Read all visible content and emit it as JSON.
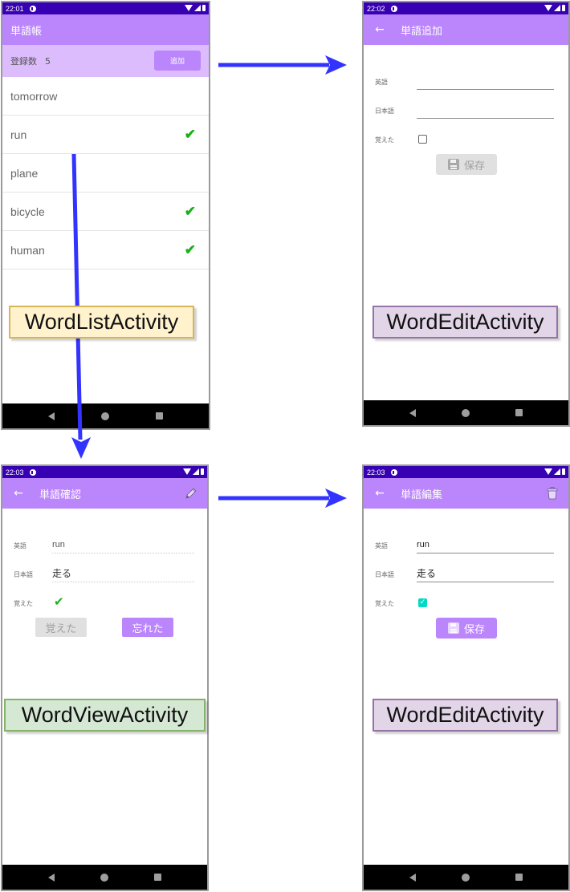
{
  "status_icons": [
    "wifi-icon",
    "signal-icon",
    "battery-icon"
  ],
  "nav_icons": [
    "back-triangle-icon",
    "home-circle-icon",
    "recents-square-icon"
  ],
  "colors": {
    "status_bar": "#3700b3",
    "app_bar": "#bb86fc",
    "count_bar": "#dcbcfd",
    "check_green": "#19b019",
    "checkbox_teal": "#03dac5",
    "arrow_blue": "#3333ff"
  },
  "screens": {
    "word_list": {
      "time": "22:01",
      "title": "単語帳",
      "count_label": "登録数",
      "count_value": "5",
      "add_button": "追加",
      "items": [
        {
          "word": "tomorrow",
          "learned": false
        },
        {
          "word": "run",
          "learned": true
        },
        {
          "word": "plane",
          "learned": false
        },
        {
          "word": "bicycle",
          "learned": true
        },
        {
          "word": "human",
          "learned": true
        }
      ],
      "check_glyph": "✔",
      "activity_label": "WordListActivity"
    },
    "word_add": {
      "time": "22:02",
      "back_glyph": "←",
      "title": "単語追加",
      "english_label": "英語",
      "english_value": "",
      "japanese_label": "日本語",
      "japanese_value": "",
      "learned_label": "覚えた",
      "learned_checked": false,
      "save_button": "保存",
      "save_enabled": false,
      "activity_label": "WordEditActivity"
    },
    "word_view": {
      "time": "22:03",
      "back_glyph": "←",
      "title": "単語確認",
      "english_label": "英語",
      "english_value": "run",
      "japanese_label": "日本語",
      "japanese_value": "走る",
      "learned_label": "覚えた",
      "learned_glyph": "✔",
      "learned_button": "覚えた",
      "forgot_button": "忘れた",
      "activity_label": "WordViewActivity"
    },
    "word_edit": {
      "time": "22:03",
      "back_glyph": "←",
      "title": "単語編集",
      "english_label": "英語",
      "english_value": "run",
      "japanese_label": "日本語",
      "japanese_value": "走る",
      "learned_label": "覚えた",
      "learned_checked": true,
      "checkbox_glyph": "✓",
      "save_button": "保存",
      "save_enabled": true,
      "activity_label": "WordEditActivity"
    }
  },
  "transitions": [
    {
      "from": "WordListActivity",
      "to": "WordEditActivity",
      "trigger": "追加"
    },
    {
      "from": "WordListActivity",
      "to": "WordViewActivity",
      "trigger": "run"
    },
    {
      "from": "WordViewActivity",
      "to": "WordEditActivity",
      "trigger": "edit"
    }
  ]
}
